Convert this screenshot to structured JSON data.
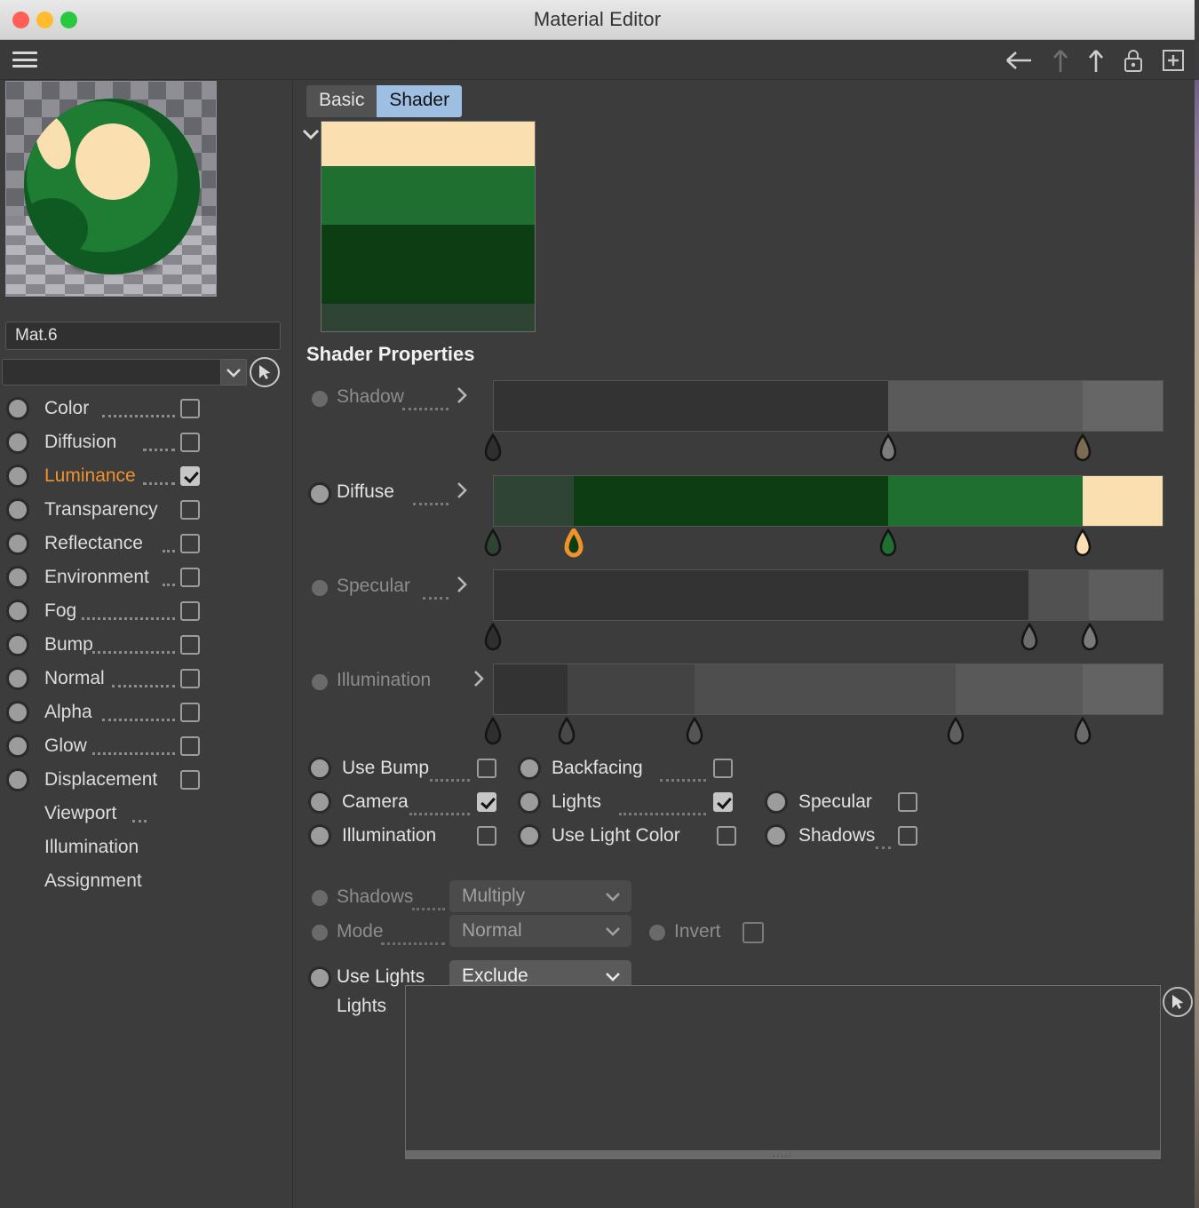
{
  "window": {
    "title": "Material Editor",
    "traffic_lights": [
      "close",
      "minimize",
      "zoom"
    ]
  },
  "toolbar": {
    "menu_icon": "hamburger-icon",
    "icons": [
      "back-arrow-icon",
      "up-arrow-dim-icon",
      "up-arrow-icon",
      "lock-icon",
      "add-box-icon"
    ]
  },
  "left_panel": {
    "preview_alt": "material-sphere-preview",
    "name_value": "Mat.6",
    "picker_value": "",
    "picker_arrow_icon": "chevron-down-icon",
    "cursor_picker_icon": "cursor-pick-icon",
    "channels": [
      {
        "label": "Color",
        "checked": false,
        "active": false,
        "has_controls": true
      },
      {
        "label": "Diffusion",
        "checked": false,
        "active": false,
        "has_controls": true
      },
      {
        "label": "Luminance",
        "checked": true,
        "active": true,
        "has_controls": true
      },
      {
        "label": "Transparency",
        "checked": false,
        "active": false,
        "has_controls": true
      },
      {
        "label": "Reflectance",
        "checked": false,
        "active": false,
        "has_controls": true
      },
      {
        "label": "Environment",
        "checked": false,
        "active": false,
        "has_controls": true
      },
      {
        "label": "Fog",
        "checked": false,
        "active": false,
        "has_controls": true
      },
      {
        "label": "Bump",
        "checked": false,
        "active": false,
        "has_controls": true
      },
      {
        "label": "Normal",
        "checked": false,
        "active": false,
        "has_controls": true
      },
      {
        "label": "Alpha",
        "checked": false,
        "active": false,
        "has_controls": true
      },
      {
        "label": "Glow",
        "checked": false,
        "active": false,
        "has_controls": true
      },
      {
        "label": "Displacement",
        "checked": false,
        "active": false,
        "has_controls": true
      },
      {
        "label": "Viewport",
        "checked": false,
        "active": false,
        "has_controls": false
      },
      {
        "label": "Illumination",
        "checked": false,
        "active": false,
        "has_controls": false
      },
      {
        "label": "Assignment",
        "checked": false,
        "active": false,
        "has_controls": false
      }
    ]
  },
  "right_panel": {
    "tabs": [
      {
        "label": "Basic",
        "active": false
      },
      {
        "label": "Shader",
        "active": true
      }
    ],
    "preview_chevron_icon": "chevron-down-icon",
    "shader_preview_bands": [
      {
        "color": "#fae0b0",
        "height_pct": 21
      },
      {
        "color": "#1f7030",
        "height_pct": 28
      },
      {
        "color": "#0d3d12",
        "height_pct": 38
      },
      {
        "color": "#2f4434",
        "height_pct": 13
      }
    ],
    "section_title": "Shader Properties",
    "gradients": [
      {
        "label": "Shadow",
        "enabled": false,
        "expand_icon": "chevron-right-icon",
        "bands": [
          {
            "color": "#333333",
            "width_pct": 59
          },
          {
            "color": "#5a5a5a",
            "width_pct": 29
          },
          {
            "color": "#666666",
            "width_pct": 12
          }
        ],
        "handles": [
          {
            "pos_pct": 0,
            "color": "#2f2f2f"
          },
          {
            "pos_pct": 59,
            "color": "#7c7c7c"
          },
          {
            "pos_pct": 88,
            "color": "#7d6a52"
          }
        ]
      },
      {
        "label": "Diffuse",
        "enabled": true,
        "expand_icon": "chevron-right-icon",
        "bands": [
          {
            "color": "#2f4434",
            "width_pct": 12
          },
          {
            "color": "#0d3d12",
            "width_pct": 47
          },
          {
            "color": "#1f7030",
            "width_pct": 29
          },
          {
            "color": "#fae0b0",
            "width_pct": 12
          }
        ],
        "handles": [
          {
            "pos_pct": 0,
            "color": "#2f4434",
            "selected": false
          },
          {
            "pos_pct": 12,
            "color": "#0d3d12",
            "selected": true
          },
          {
            "pos_pct": 59,
            "color": "#1f7030",
            "selected": false
          },
          {
            "pos_pct": 88,
            "color": "#fae0b0",
            "selected": false
          }
        ]
      },
      {
        "label": "Specular",
        "enabled": false,
        "expand_icon": "chevron-right-icon",
        "bands": [
          {
            "color": "#333333",
            "width_pct": 80
          },
          {
            "color": "#515151",
            "width_pct": 9
          },
          {
            "color": "#5d5d5d",
            "width_pct": 11
          }
        ],
        "handles": [
          {
            "pos_pct": 0,
            "color": "#2f2f2f"
          },
          {
            "pos_pct": 80,
            "color": "#6c6c6c"
          },
          {
            "pos_pct": 89,
            "color": "#7a7a7a"
          }
        ]
      },
      {
        "label": "Illumination",
        "enabled": false,
        "expand_icon": "chevron-right-icon",
        "bands": [
          {
            "color": "#333333",
            "width_pct": 11
          },
          {
            "color": "#434343",
            "width_pct": 19
          },
          {
            "color": "#4e4e4e",
            "width_pct": 39
          },
          {
            "color": "#595959",
            "width_pct": 19
          },
          {
            "color": "#636363",
            "width_pct": 12
          }
        ],
        "handles": [
          {
            "pos_pct": 0,
            "color": "#2f2f2f"
          },
          {
            "pos_pct": 11,
            "color": "#484848"
          },
          {
            "pos_pct": 30,
            "color": "#555555"
          },
          {
            "pos_pct": 69,
            "color": "#5f5f5f"
          },
          {
            "pos_pct": 88,
            "color": "#6b6b6b"
          }
        ]
      }
    ],
    "toggles": [
      {
        "label": "Use Bump",
        "checked": false,
        "col": 0,
        "row": 0
      },
      {
        "label": "Backfacing",
        "checked": false,
        "col": 1,
        "row": 0
      },
      {
        "label": "Camera",
        "checked": true,
        "col": 0,
        "row": 1
      },
      {
        "label": "Lights",
        "checked": true,
        "col": 1,
        "row": 1
      },
      {
        "label": "Specular",
        "checked": false,
        "col": 2,
        "row": 1
      },
      {
        "label": "Illumination",
        "checked": false,
        "col": 0,
        "row": 2
      },
      {
        "label": "Use Light Color",
        "checked": false,
        "col": 1,
        "row": 2
      },
      {
        "label": "Shadows",
        "checked": false,
        "col": 2,
        "row": 2
      }
    ],
    "selects": [
      {
        "label": "Shadows",
        "value": "Multiply",
        "enabled": false,
        "arrow_icon": "chevron-down-icon"
      },
      {
        "label": "Mode",
        "value": "Normal",
        "enabled": false,
        "arrow_icon": "chevron-down-icon"
      },
      {
        "label": "Use Lights",
        "value": "Exclude",
        "enabled": true,
        "arrow_icon": "chevron-down-icon"
      }
    ],
    "invert": {
      "label": "Invert",
      "checked": false
    },
    "lights": {
      "label": "Lights",
      "items": [],
      "cursor_icon": "cursor-pick-icon",
      "resize_grip": "....."
    }
  },
  "colors": {
    "accent_orange": "#f0922c",
    "tab_active_bg": "#9ebfe2",
    "panel_bg": "#3c3c3c"
  }
}
